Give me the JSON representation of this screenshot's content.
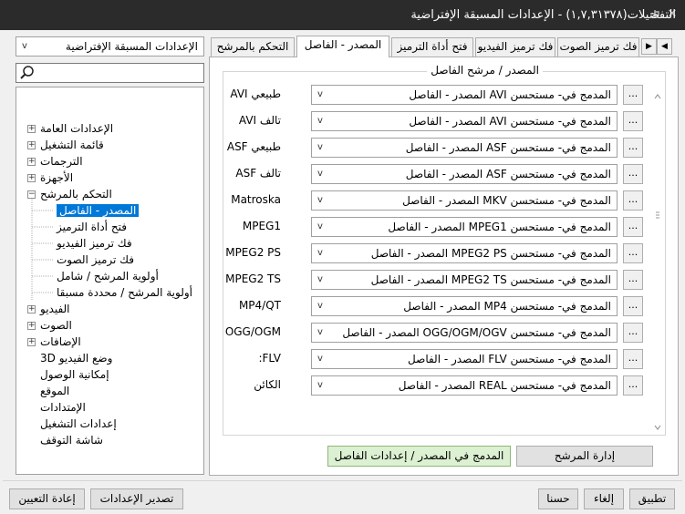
{
  "window": {
    "title": "التفضيلات(١,٧,٣١٣٧٨) - الإعدادات المسبقة الإفتراضية",
    "pin_glyph": "✕",
    "close_glyph": "✕"
  },
  "preset_combo": {
    "value": "الإعدادات المسبقة الإفتراضية"
  },
  "search": {
    "value": "",
    "placeholder": ""
  },
  "tree": [
    {
      "label": "الإعدادات العامة",
      "expander": "+"
    },
    {
      "label": "قائمة التشغيل",
      "expander": "+"
    },
    {
      "label": "الترجمات",
      "expander": "+"
    },
    {
      "label": "الأجهزة",
      "expander": "+"
    },
    {
      "label": "التحكم بالمرشح",
      "expander": "−"
    },
    {
      "label": "المصدر - الفاصل",
      "child": true,
      "selected": true
    },
    {
      "label": "فتح أداة الترميز",
      "child": true
    },
    {
      "label": "فك ترميز الفيديو",
      "child": true
    },
    {
      "label": "فك ترميز الصوت",
      "child": true
    },
    {
      "label": "أولوية المرشح / شامل",
      "child": true
    },
    {
      "label": "أولوية المرشح / محددة مسبقا",
      "child": true
    },
    {
      "label": "الفيديو",
      "expander": "+"
    },
    {
      "label": "الصوت",
      "expander": "+"
    },
    {
      "label": "الإضافات",
      "expander": "+"
    },
    {
      "label": "وضع الفيديو 3D"
    },
    {
      "label": "إمكانية الوصول"
    },
    {
      "label": "الموقع"
    },
    {
      "label": "الإمتدادات"
    },
    {
      "label": "إعدادات التشغيل"
    },
    {
      "label": "شاشة التوقف"
    }
  ],
  "tabs": [
    {
      "label": "التحكم بالمرشح"
    },
    {
      "label": "المصدر - الفاصل",
      "active": true
    },
    {
      "label": "فتح أداة الترميز"
    },
    {
      "label": "فك ترميز الفيديو"
    },
    {
      "label": "فك ترميز الصوت"
    }
  ],
  "tab_scroll": {
    "left": "◀",
    "right": "▶"
  },
  "group": {
    "label": "المصدر / مرشح الفاصل",
    "rows": [
      {
        "label": "طبيعي AVI",
        "value": "المدمج في- مستحسن AVI المصدر - الفاصل"
      },
      {
        "label": "تالف AVI",
        "value": "المدمج في- مستحسن AVI المصدر - الفاصل"
      },
      {
        "label": "طبيعي ASF",
        "value": "المدمج في- مستحسن ASF المصدر - الفاصل"
      },
      {
        "label": "تالف ASF",
        "value": "المدمج في- مستحسن ASF المصدر - الفاصل"
      },
      {
        "label": "Matroska",
        "value": "المدمج في- مستحسن MKV المصدر - الفاصل"
      },
      {
        "label": "MPEG1",
        "value": "المدمج في- مستحسن MPEG1 المصدر - الفاصل"
      },
      {
        "label": "MPEG2 PS",
        "value": "المدمج في- مستحسن MPEG2 PS المصدر - الفاصل"
      },
      {
        "label": "MPEG2 TS",
        "value": "المدمج في- مستحسن MPEG2 TS المصدر - الفاصل"
      },
      {
        "label": "MP4/QT",
        "value": "المدمج في- مستحسن MP4 المصدر - الفاصل"
      },
      {
        "label": "OGG/OGM",
        "value": "المدمج في- مستحسن OGG/OGM/OGV المصدر - الفاصل"
      },
      {
        "label": "FLV:",
        "value": "المدمج في- مستحسن FLV المصدر - الفاصل"
      },
      {
        "label": "الكائن",
        "value": "المدمج في- مستحسن REAL المصدر - الفاصل"
      }
    ],
    "dots_label": "..."
  },
  "panel_buttons": {
    "filter_manage": "إدارة المرشح",
    "builtin_splitter": "المدمج في المصدر / إعدادات الفاصل"
  },
  "footer": {
    "apply": "تطبيق",
    "cancel": "إلغاء",
    "ok": "حسنا",
    "export": "تصدير الإعدادات",
    "reset": "إعادة التعيين"
  },
  "colors": {
    "selection": "#0078d7",
    "titlebar": "#2b2b2b",
    "accent_button": "#dcf0d2"
  }
}
